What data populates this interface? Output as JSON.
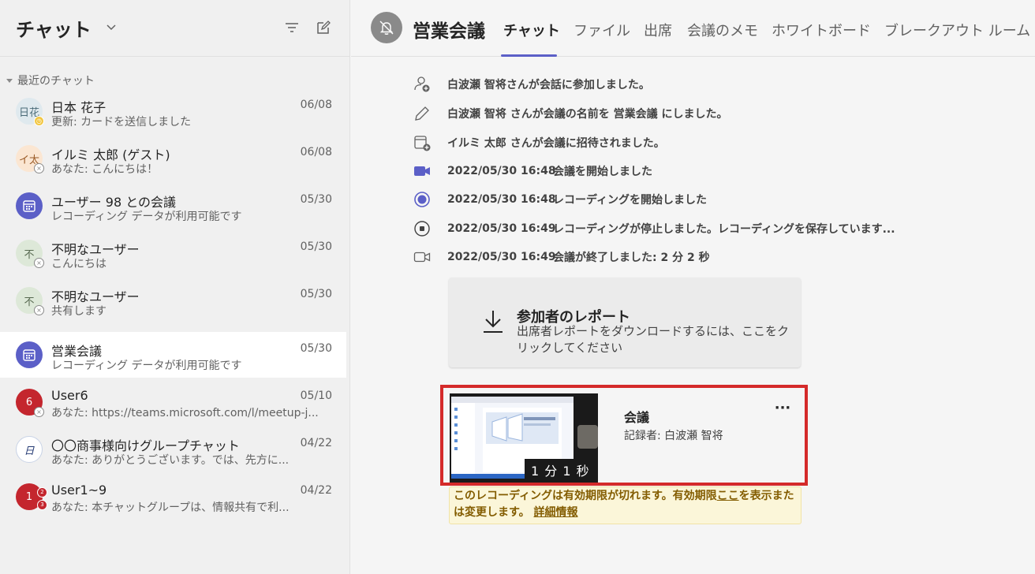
{
  "left": {
    "title": "チャット",
    "section_label": "最近のチャット",
    "chats": [
      {
        "avatar": "日花",
        "avatar_bg": "#dfe9ee",
        "avatar_color": "#4a6b78",
        "badge": "clock",
        "name": "日本 花子",
        "date": "06/08",
        "preview": "更新: カードを送信しました"
      },
      {
        "avatar": "イ太",
        "avatar_bg": "#fbe6d2",
        "avatar_color": "#9a5a25",
        "badge": "x",
        "name": "イルミ 太郎 (ゲスト)",
        "date": "06/08",
        "preview": "あなた: こんにちは！"
      },
      {
        "avatar": "cal",
        "avatar_bg": "#5b5fc7",
        "avatar_color": "#ffffff",
        "badge": "",
        "name": "ユーザー 98 との会議",
        "date": "05/30",
        "preview": "レコーディング データが利用可能です"
      },
      {
        "avatar": "不",
        "avatar_bg": "#dde8d8",
        "avatar_color": "#56684f",
        "badge": "x",
        "name": "不明なユーザー",
        "date": "05/30",
        "preview": "こんにちは"
      },
      {
        "avatar": "不",
        "avatar_bg": "#dde8d8",
        "avatar_color": "#56684f",
        "badge": "x",
        "name": "不明なユーザー",
        "date": "05/30",
        "preview": "共有します"
      },
      {
        "avatar": "cal",
        "avatar_bg": "#5b5fc7",
        "avatar_color": "#ffffff",
        "badge": "",
        "name": "営業会議",
        "date": "05/30",
        "preview": "レコーディング データが利用可能です",
        "selected": true
      },
      {
        "avatar": "6",
        "avatar_bg": "#c4262e",
        "avatar_color": "#ffffff",
        "badge": "x",
        "name": "User6",
        "date": "05/10",
        "preview": "あなた: https://teams.microsoft.com/l/meetup-j..."
      },
      {
        "avatar": "日",
        "avatar_bg": "#ffffff",
        "avatar_color": "#243a73",
        "badge": "",
        "name": "〇〇商事様向けグループチャット",
        "date": "04/22",
        "preview": "あなた: ありがとうございます。では、先方に..."
      },
      {
        "avatar": "1",
        "avatar_bg": "#c4262e",
        "avatar_color": "#ffffff",
        "badge": "group",
        "name": "User1~9",
        "date": "04/22",
        "preview": "あなた: 本チャットグループは、情報共有で利..."
      }
    ]
  },
  "header": {
    "meeting_title": "営業会議",
    "tabs": [
      "チャット",
      "ファイル",
      "出席",
      "会議のメモ",
      "ホワイトボード",
      "ブレークアウト ルーム"
    ]
  },
  "events": [
    {
      "icon": "person-add-icon",
      "time": "",
      "text": "白波瀬 智将さんが会話に参加しました。"
    },
    {
      "icon": "pencil-icon",
      "time": "",
      "text": "白波瀬 智将 さんが会議の名前を 営業会議 にしました。"
    },
    {
      "icon": "calendar-add-icon",
      "time": "",
      "text": "イルミ 太郎 さんが会議に招待されました。"
    },
    {
      "icon": "video-filled-icon",
      "time": "2022/05/30 16:48",
      "text": "会議を開始しました"
    },
    {
      "icon": "record-icon",
      "time": "2022/05/30 16:48",
      "text": "レコーディングを開始しました"
    },
    {
      "icon": "stop-icon",
      "time": "2022/05/30 16:49",
      "text": "レコーディングが停止しました。レコーディングを保存しています..."
    },
    {
      "icon": "video-outline-icon",
      "time": "2022/05/30 16:49",
      "text": "会議が終了しました: 2 分 2 秒"
    }
  ],
  "report": {
    "title": "参加者のレポート",
    "description": "出席者レポートをダウンロードするには、ここをクリックしてください"
  },
  "recording": {
    "title": "会議",
    "recorder": "記録者: 白波瀬 智将",
    "duration": "1 分 1 秒",
    "more": "···"
  },
  "expiry": {
    "text1": "このレコーディングは有効期限が切れます。有効期限",
    "link1": "ここ",
    "text2": "を表示または変更します。",
    "link2": "詳細情報"
  }
}
